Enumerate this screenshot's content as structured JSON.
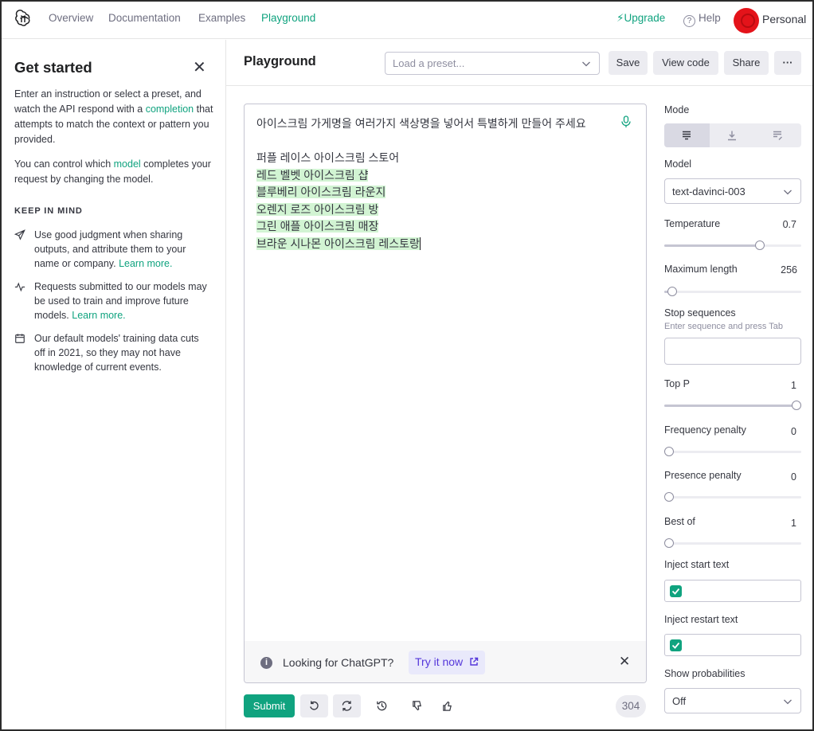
{
  "nav": {
    "links": [
      "Overview",
      "Documentation",
      "Examples",
      "Playground"
    ],
    "upgrade": "Upgrade",
    "help": "Help",
    "account": "Personal",
    "accent": "#10a37f"
  },
  "sidebar": {
    "title": "Get started",
    "intro_a": "Enter an instruction or select a preset, and watch the API respond with a ",
    "intro_link": "completion",
    "intro_b": " that attempts to match the context or pattern you provided.",
    "model_a": "You can control which ",
    "model_link": "model",
    "model_b": " completes your request by changing the model.",
    "keep_heading": "KEEP IN MIND",
    "tips": [
      {
        "icon": "send-icon",
        "text": "Use good judgment when sharing outputs, and attribute them to your name or company. ",
        "link": "Learn more."
      },
      {
        "icon": "activity-icon",
        "text": "Requests submitted to our models may be used to train and improve future models. ",
        "link": "Learn more."
      },
      {
        "icon": "calendar-icon",
        "text": "Our default models' training data cuts off in 2021, so they may not have knowledge of current events.",
        "link": ""
      }
    ]
  },
  "header": {
    "title": "Playground",
    "preset_placeholder": "Load a preset...",
    "buttons": {
      "save": "Save",
      "view_code": "View code",
      "share": "Share",
      "more": "···"
    }
  },
  "editor": {
    "prompt": "아이스크림 가게명을 여러가지 색상명을 넣어서 특별하게 만들어 주세요\n\n퍼플 레이스 아이스크림 스토어",
    "completion": [
      "레드 벨벳 아이스크림 샵",
      "블루베리 아이스크림 라운지",
      "오렌지 로즈 아이스크림 방",
      "그린 애플 아이스크림 매장",
      "브라운 시나몬 아이스크림 레스토랑"
    ],
    "banner_text": "Looking for ChatGPT?",
    "banner_link": "Try it now"
  },
  "footer": {
    "submit": "Submit",
    "token_count": "304"
  },
  "settings": {
    "mode_label": "Mode",
    "model_label": "Model",
    "model_value": "text-davinci-003",
    "temperature": {
      "label": "Temperature",
      "value": "0.7",
      "fraction": 0.7
    },
    "max_length": {
      "label": "Maximum length",
      "value": "256",
      "fraction": 0.06
    },
    "stop": {
      "label": "Stop sequences",
      "hint": "Enter sequence and press Tab"
    },
    "top_p": {
      "label": "Top P",
      "value": "1",
      "fraction": 1.0
    },
    "frequency": {
      "label": "Frequency penalty",
      "value": "0",
      "fraction": 0
    },
    "presence": {
      "label": "Presence penalty",
      "value": "0",
      "fraction": 0
    },
    "best_of": {
      "label": "Best of",
      "value": "1",
      "fraction": 0
    },
    "inject_start": {
      "label": "Inject start text",
      "checked": true
    },
    "inject_restart": {
      "label": "Inject restart text",
      "checked": true
    },
    "show_prob": {
      "label": "Show probabilities",
      "value": "Off"
    }
  }
}
